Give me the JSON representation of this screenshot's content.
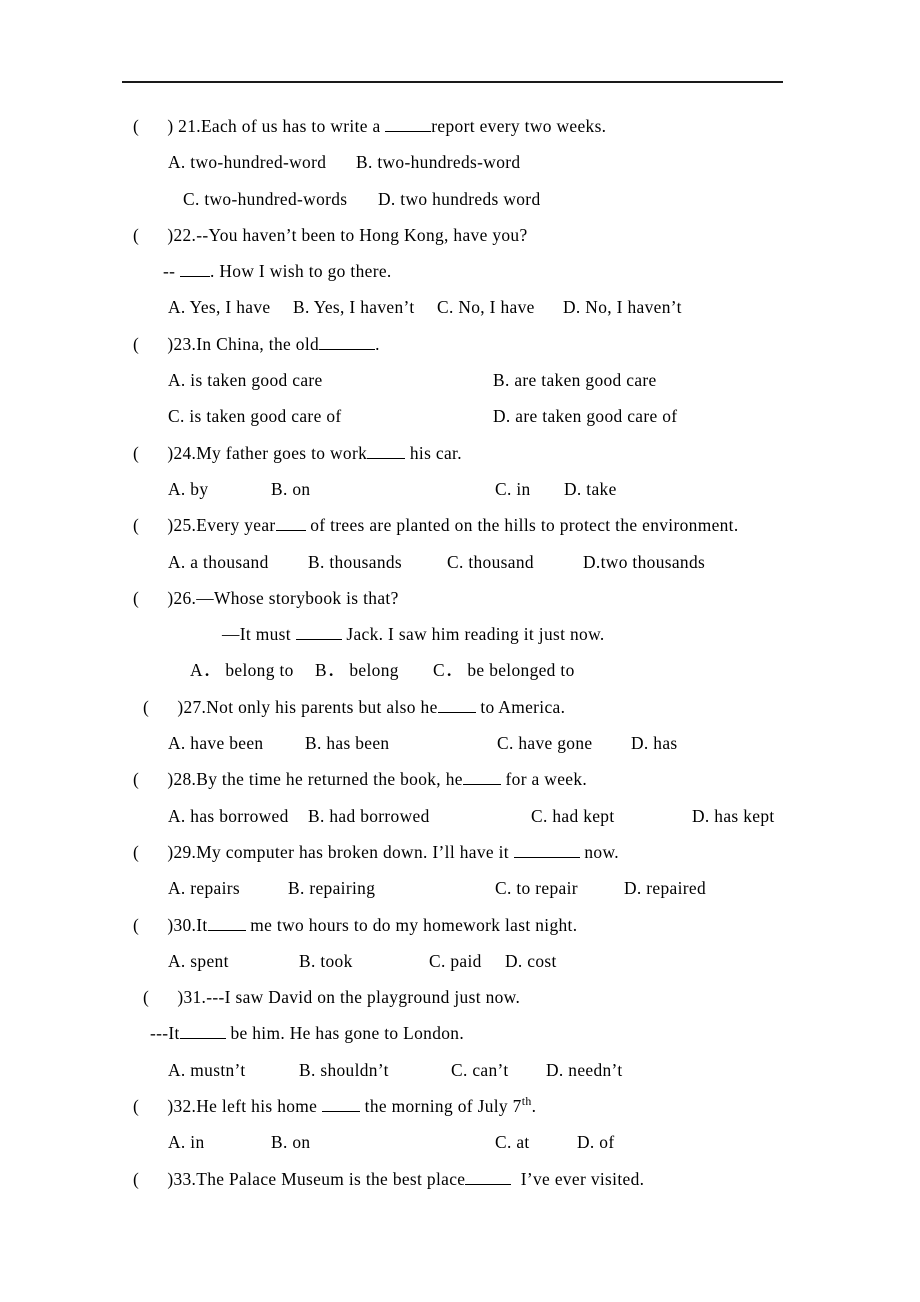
{
  "document": {
    "type": "english-grammar-multiple-choice-worksheet",
    "header_rule": true
  },
  "questions": [
    {
      "marker": "(      ) 21.",
      "stem_pre": "Each of us has to write a ",
      "blank": "_____",
      "stem_post": "report every two weeks.",
      "option_rows": [
        {
          "indent": "normal",
          "options": [
            "A. two-hundred-word",
            "B. two-hundreds-word"
          ]
        },
        {
          "indent": "extra",
          "options": [
            "C. two-hundred-words",
            "D. two hundreds word"
          ]
        }
      ]
    },
    {
      "marker": "(      )22.",
      "stem_pre": "--You haven’t been to Hong Kong, have you?",
      "blank": "",
      "stem_post": "",
      "continuation": {
        "pre": "-- ",
        "blank": "___",
        "post": ". How I wish to go there."
      },
      "option_rows": [
        {
          "indent": "normal",
          "options": [
            "A. Yes, I have",
            "B. Yes, I haven’t",
            "C. No, I have",
            "D. No, I haven’t"
          ]
        }
      ]
    },
    {
      "marker": "(      )23.",
      "stem_pre": "In China, the old",
      "blank": "______",
      "stem_post": ".",
      "option_rows": [
        {
          "indent": "normal",
          "options": [
            "A. is taken good care",
            "B. are taken good care"
          ]
        },
        {
          "indent": "normal",
          "options": [
            "C. is taken good care of",
            "D. are taken good care of"
          ]
        }
      ]
    },
    {
      "marker": "(      )24.",
      "stem_pre": "My father goes to work",
      "blank": "____",
      "stem_post": " his car.",
      "option_rows": [
        {
          "indent": "normal",
          "options": [
            "A. by",
            "B. on",
            "C. in",
            "D. take"
          ]
        }
      ]
    },
    {
      "marker": "(      )25.",
      "stem_pre": "Every year",
      "blank": "___",
      "stem_post": " of trees are planted on the hills to protect the environment.",
      "option_rows": [
        {
          "indent": "normal",
          "options": [
            "A. a thousand",
            "B. thousands",
            "C. thousand",
            "D.two thousands"
          ]
        }
      ]
    },
    {
      "marker": "(      )26.",
      "stem_pre": "—Whose storybook is that?",
      "blank": "",
      "stem_post": "",
      "continuation": {
        "pre": "—It must ",
        "blank": "_____",
        "post": " Jack. I saw him reading it just now."
      },
      "option_rows": [
        {
          "indent": "q26",
          "options": [
            "A． belong to",
            "B． belong",
            "C． be belonged to"
          ]
        }
      ]
    },
    {
      "marker": "(      )27.",
      "stem_pre": "Not only his parents but also he",
      "blank": "____",
      "stem_post": " to America.",
      "option_rows": [
        {
          "indent": "normal",
          "options": [
            "A. have been",
            "B. has been",
            "C. have gone",
            "D. has"
          ]
        }
      ]
    },
    {
      "marker": "(      )28.",
      "stem_pre": "By the time he returned the book, he",
      "blank": "____",
      "stem_post": " for a week.",
      "option_rows": [
        {
          "indent": "normal",
          "options": [
            "A. has borrowed",
            "B. had borrowed",
            "C. had kept",
            "D. has kept"
          ]
        }
      ]
    },
    {
      "marker": "(      )29.",
      "stem_pre": "My computer has broken down. I’ll have it ",
      "blank": "_______",
      "stem_post": " now.",
      "option_rows": [
        {
          "indent": "normal",
          "options": [
            "A. repairs",
            "B. repairing",
            "C. to repair",
            "D. repaired"
          ]
        }
      ]
    },
    {
      "marker": "(      )30.",
      "stem_pre": "It",
      "blank": "____",
      "stem_post": " me two hours to do my homework last night.",
      "option_rows": [
        {
          "indent": "normal",
          "options": [
            "A. spent",
            "B. took",
            "C. paid",
            "D. cost"
          ]
        }
      ]
    },
    {
      "marker": "(      )31.",
      "stem_pre": "---I saw David on the playground just now.",
      "blank": "",
      "stem_post": "",
      "continuation": {
        "pre": "---It",
        "blank": "_____",
        "post": " be him. He has gone to London."
      },
      "option_rows": [
        {
          "indent": "normal",
          "options": [
            "A. mustn’t",
            "B. shouldn’t",
            "C. can’t",
            "D. needn’t"
          ]
        }
      ]
    },
    {
      "marker": "(      )32.",
      "stem_pre": "He left his home ",
      "blank": "____",
      "stem_post": " the morning of July 7",
      "superscript": "th",
      "stem_tail": ".",
      "option_rows": [
        {
          "indent": "normal",
          "options": [
            "A. in",
            "B. on",
            "C. at",
            "D. of"
          ]
        }
      ]
    },
    {
      "marker": "(      )33.",
      "stem_pre": "The Palace Museum is the best place",
      "blank": "_____",
      "stem_post": "  I’ve ever visited.",
      "option_rows": []
    }
  ]
}
